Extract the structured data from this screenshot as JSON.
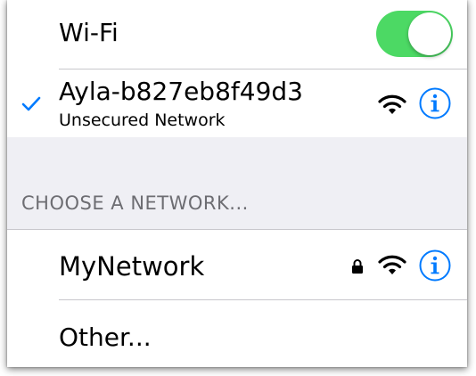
{
  "wifi": {
    "label": "Wi-Fi",
    "enabled": true,
    "toggle_color": "#4cd964"
  },
  "connected_network": {
    "name": "Ayla-b827eb8f49d3",
    "subtitle": "Unsecured Network",
    "selected": true,
    "icons": [
      "checkmark-icon",
      "wifi-signal-icon",
      "info-icon"
    ]
  },
  "section": {
    "header": "CHOOSE A NETWORK..."
  },
  "networks": [
    {
      "name": "MyNetwork",
      "locked": true,
      "icons": [
        "lock-icon",
        "wifi-signal-icon",
        "info-icon"
      ]
    }
  ],
  "other": {
    "label": "Other..."
  },
  "colors": {
    "accent": "#007aff",
    "section_background": "#efeff4",
    "section_header_text": "#6d6d72",
    "separator": "#c8c7cc"
  }
}
